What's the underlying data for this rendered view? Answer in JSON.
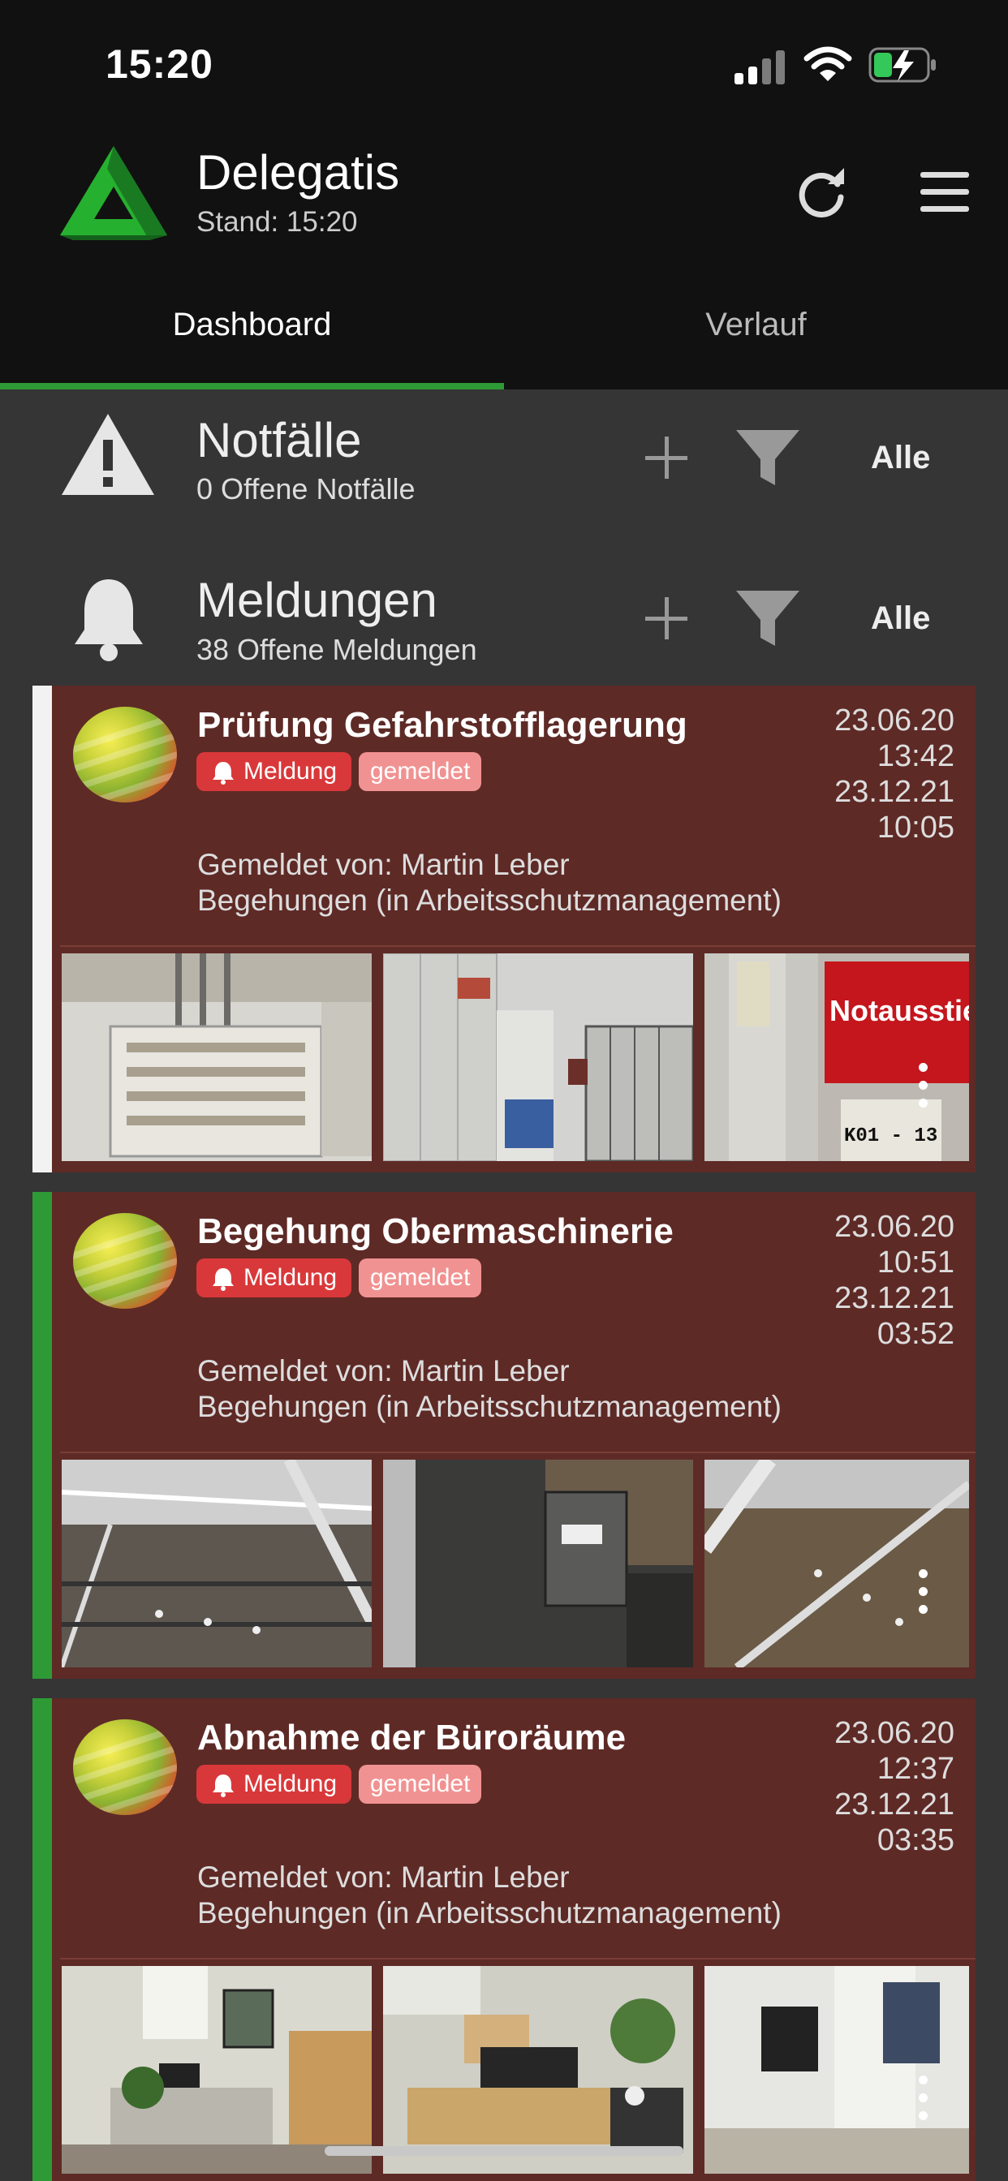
{
  "status": {
    "time": "15:20"
  },
  "app": {
    "title": "Delegatis",
    "subtitle": "Stand: 15:20",
    "icons": [
      "logo-icon",
      "refresh-icon",
      "menu-icon"
    ]
  },
  "tabs": [
    {
      "label": "Dashboard",
      "active": true
    },
    {
      "label": "Verlauf",
      "active": false
    }
  ],
  "sections": {
    "notfaelle": {
      "title": "Notfälle",
      "subtitle": "0 Offene Notfälle",
      "filter_label": "Alle",
      "icon": "warning-icon"
    },
    "meldungen": {
      "title": "Meldungen",
      "subtitle": "38 Offene Meldungen",
      "filter_label": "Alle",
      "icon": "bell-icon"
    }
  },
  "cards": [
    {
      "title": "Prüfung Gefahrstofflagerung",
      "badge_type": "Meldung",
      "badge_status": "gemeldet",
      "date1": "23.06.20",
      "time1": "13:42",
      "date2": "23.12.21",
      "time2": "10:05",
      "reporter": "Gemeldet von: Martin Leber",
      "category": "Begehungen (in Arbeitsschutzmanagement)",
      "stripe_color": "#f2f2f2",
      "photos": [
        "electrical-cabinet-photo",
        "storage-room-photo"
      ],
      "photo3_sign": "Notausstie",
      "photo3_tag": "K01 - 13"
    },
    {
      "title": "Begehung Obermaschinerie",
      "badge_type": "Meldung",
      "badge_status": "gemeldet",
      "date1": "23.06.20",
      "time1": "10:51",
      "date2": "23.12.21",
      "time2": "03:52",
      "reporter": "Gemeldet von: Martin Leber",
      "category": "Begehungen (in Arbeitsschutzmanagement)",
      "stripe_color": "#2e9a36",
      "photos": [
        "stage-machinery-photo",
        "machinery-box-photo",
        "stage-grid-photo"
      ]
    },
    {
      "title": "Abnahme der Büroräume",
      "badge_type": "Meldung",
      "badge_status": "gemeldet",
      "date1": "23.06.20",
      "time1": "12:37",
      "date2": "23.12.21",
      "time2": "03:35",
      "reporter": "Gemeldet von: Martin Leber",
      "category": "Begehungen (in Arbeitsschutzmanagement)",
      "stripe_color": "#2e9a36",
      "photos": [
        "office-desk-photo",
        "office-workstation-photo",
        "office-kitchen-photo"
      ]
    }
  ],
  "colors": {
    "accent": "#2e9a36",
    "card_bg": "#5e2a26",
    "badge_meldung": "#d9383a",
    "badge_status": "#f19292"
  }
}
